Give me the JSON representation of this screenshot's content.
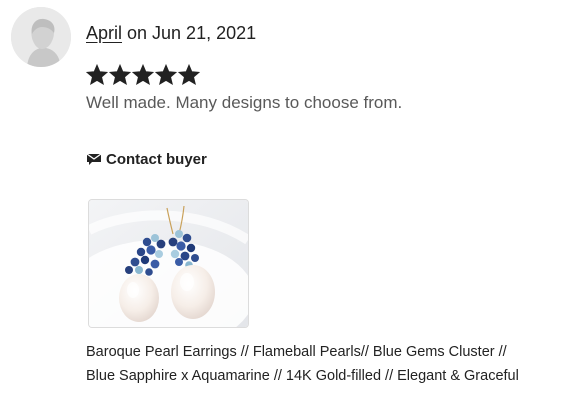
{
  "review": {
    "reviewer_name": "April",
    "date_text": " on Jun 21, 2021",
    "rating": 5,
    "rating_max": 5,
    "text": "Well made. Many designs to choose from.",
    "contact_label": "Contact buyer",
    "icons": {
      "avatar": "default-avatar-icon",
      "star": "star-icon",
      "contact": "message-envelope-icon"
    },
    "listing": {
      "title_line1": "Baroque Pearl Earrings // Flameball Pearls// Blue Gems Cluster //",
      "title_line2": "Blue Sapphire x Aquamarine // 14K Gold-filled // Elegant & Graceful"
    },
    "colors": {
      "text": "#222222",
      "muted_text": "#595959",
      "star": "#222222"
    }
  }
}
